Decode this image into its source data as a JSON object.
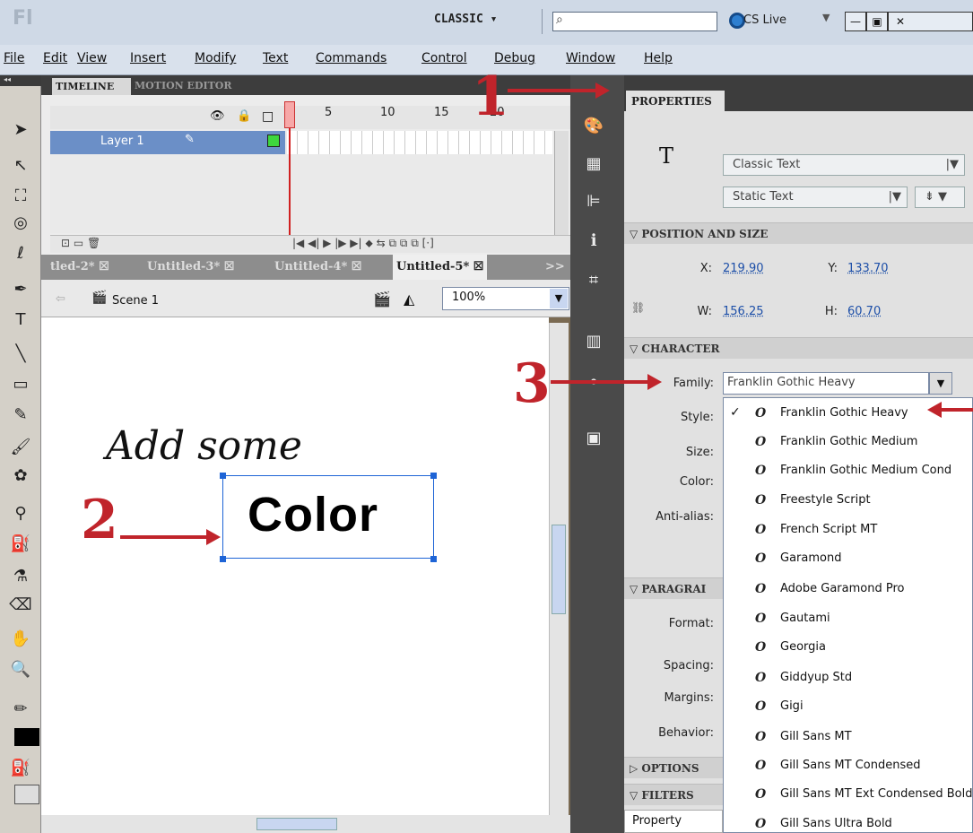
{
  "titlebar": {
    "logo": "Fl",
    "workspace": "CLASSIC ▾",
    "search_placeholder": "",
    "cs_live": "CS Live",
    "min": "—",
    "max": "▣",
    "close": "✕"
  },
  "menu": [
    "File",
    "Edit",
    "View",
    "Insert",
    "Modify",
    "Text",
    "Commands",
    "Control",
    "Debug",
    "Window",
    "Help"
  ],
  "timeline": {
    "tab": "TIMELINE",
    "tab2": "MOTION EDITOR",
    "layer": "Layer 1",
    "frames": [
      "l",
      "5",
      "10",
      "15",
      "20"
    ]
  },
  "docs": [
    "tled-2*",
    "Untitled-3*",
    "Untitled-4*",
    "Untitled-5*"
  ],
  "scene": {
    "label": "Scene 1",
    "zoom": "100%"
  },
  "stage": {
    "line1": "Add some",
    "line2": "Color"
  },
  "callouts": [
    "1",
    "2",
    "3"
  ],
  "properties": {
    "tab": "PROPERTIES",
    "text_engine": "Classic Text",
    "text_type": "Static Text",
    "section_pos": "POSITION AND SIZE",
    "x_label": "X:",
    "x": "219.90",
    "y_label": "Y:",
    "y": "133.70",
    "w_label": "W:",
    "w": "156.25",
    "h_label": "H:",
    "h": "60.70",
    "section_char": "CHARACTER",
    "family_label": "Family:",
    "family": "Franklin Gothic Heavy",
    "style_label": "Style:",
    "size_label": "Size:",
    "color_label": "Color:",
    "antialias_label": "Anti-alias:",
    "section_para": "PARAGRAI",
    "format_label": "Format:",
    "spacing_label": "Spacing:",
    "margins_label": "Margins:",
    "behavior_label": "Behavior:",
    "section_options": "OPTIONS",
    "section_filters": "FILTERS",
    "footer": "Property"
  },
  "fonts": [
    "Franklin Gothic Heavy",
    "Franklin Gothic Medium",
    "Franklin Gothic Medium Cond",
    "Freestyle Script",
    "French Script MT",
    "Garamond",
    "Adobe Garamond Pro",
    "Gautami",
    "Georgia",
    "Giddyup Std",
    "Gigi",
    "Gill Sans MT",
    "Gill Sans MT Condensed",
    "Gill Sans MT Ext Condensed Bold",
    "Gill Sans Ultra Bold"
  ],
  "selected_font": "Franklin Gothic Heavy"
}
